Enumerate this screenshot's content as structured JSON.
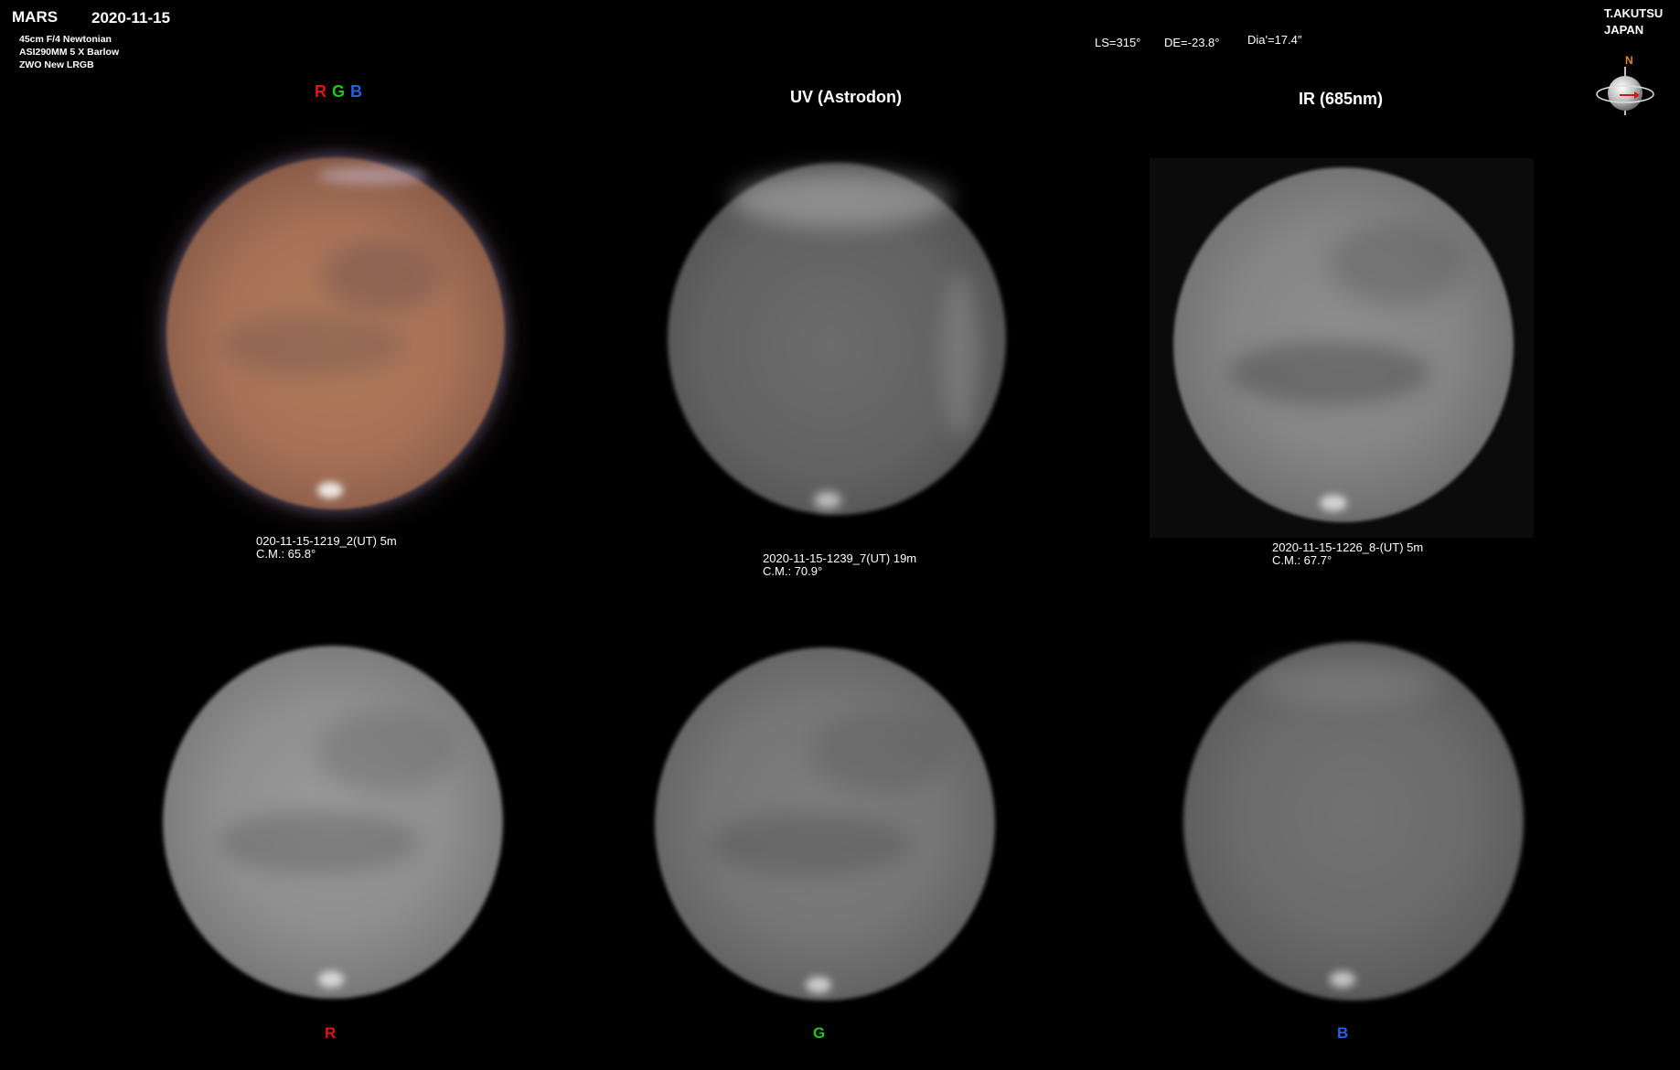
{
  "header": {
    "object": "MARS",
    "date": "2020-11-15",
    "equipment": [
      "45cm F/4  Newtonian",
      "ASI290MM    5 X  Barlow",
      "ZWO  New LRGB"
    ],
    "ls": "LS=315°",
    "de": "DE=-23.8°",
    "dia": "Dia'=17.4″",
    "observer": "T.AKUTSU",
    "country": "JAPAN",
    "compass_label": "N"
  },
  "panels": {
    "rgb": {
      "title_r": "R",
      "title_g": "G",
      "title_b": "B",
      "caption_line1": "020-11-15-1219_2(UT)  5m",
      "caption_line2": "C.M.:    65.8°"
    },
    "uv": {
      "title": "UV  (Astrodon)",
      "caption_line1": "2020-11-15-1239_7(UT)   19m",
      "caption_line2": "C.M.:    70.9°"
    },
    "ir": {
      "title": "IR (685nm)",
      "caption_line1": "2020-11-15-1226_8-(UT)   5m",
      "caption_line2": " C.M.:    67.7°"
    },
    "r": {
      "label": "R"
    },
    "g": {
      "label": "G"
    },
    "b": {
      "label": "B"
    }
  },
  "colors": {
    "red": "#e8101a",
    "green": "#22c51e",
    "blue": "#2a5fe0",
    "orange": "#e08a1e"
  }
}
